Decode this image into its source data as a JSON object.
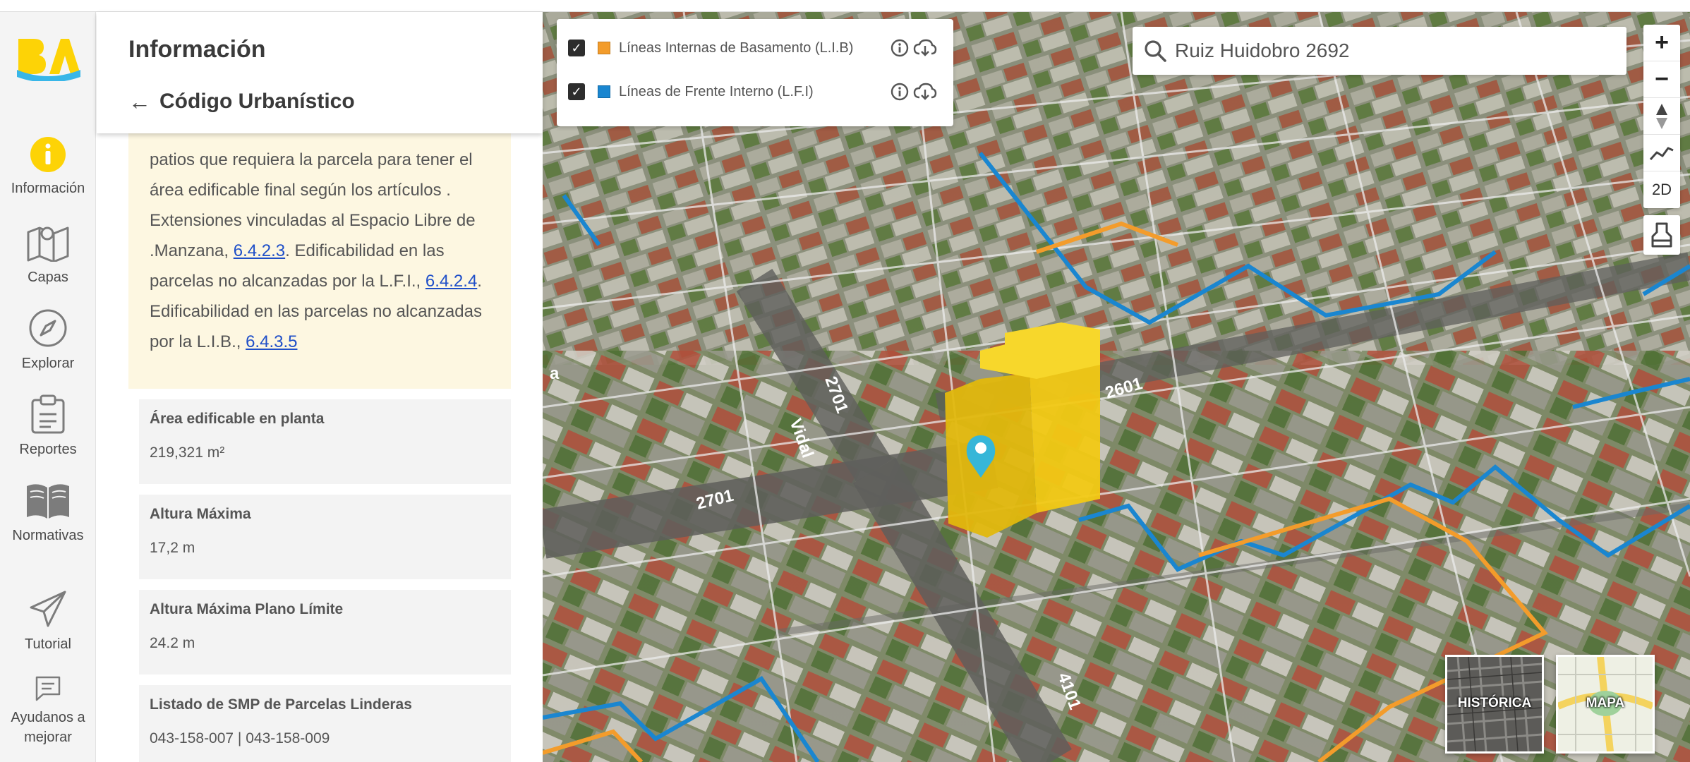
{
  "rail": {
    "items": [
      {
        "label": "Información",
        "icon": "info-icon"
      },
      {
        "label": "Capas",
        "icon": "map-icon"
      },
      {
        "label": "Explorar",
        "icon": "compass-icon"
      },
      {
        "label": "Reportes",
        "icon": "clipboard-icon"
      },
      {
        "label": "Normativas",
        "icon": "book-icon"
      },
      {
        "label": "Tutorial",
        "icon": "paper-plane-icon"
      },
      {
        "label_line1": "Ayudanos a",
        "label_line2": "mejorar",
        "icon": "chat-icon"
      }
    ],
    "active_color": "#fdd306"
  },
  "panel": {
    "title": "Información",
    "back_label": "Código Urbanístico",
    "note": {
      "text_1": "patios que requiera la parcela para tener el área edificable final según los artículos . Extensiones vinculadas al Espacio Libre de .Manzana, ",
      "link_1": "6.4.2.3",
      "text_2": ". Edificabilidad en las parcelas no alcanzadas por la L.F.I., ",
      "link_2": "6.4.2.4",
      "text_3": ". Edificabilidad en las parcelas no alcanzadas por la L.I.B., ",
      "link_3": "6.4.3.5"
    },
    "cards": [
      {
        "label": "Área edificable en planta",
        "value": "219,321 m²"
      },
      {
        "label": "Altura Máxima",
        "value": "17,2 m"
      },
      {
        "label": "Altura Máxima Plano Límite",
        "value": "24.2 m"
      },
      {
        "label": "Listado de SMP de Parcelas Linderas",
        "value": "043-158-007 | 043-158-009"
      }
    ]
  },
  "layers": [
    {
      "label": "Líneas Internas de Basamento (L.I.B)",
      "color": "#f39c2b",
      "checked": true
    },
    {
      "label": "Líneas de Frente Interno (L.F.I)",
      "color": "#1a86d0",
      "checked": true
    }
  ],
  "search": {
    "value": "Ruiz Huidobro 2692"
  },
  "map_controls": {
    "zoom_in": "+",
    "zoom_out": "−",
    "mode_2d": "2D"
  },
  "street_labels": {
    "a": "2701",
    "b": "2601",
    "c": "Vidal",
    "d": "2701",
    "e": "4101",
    "f": "a"
  },
  "basemaps": {
    "historic": "HISTÓRICA",
    "map": "MAPA"
  }
}
